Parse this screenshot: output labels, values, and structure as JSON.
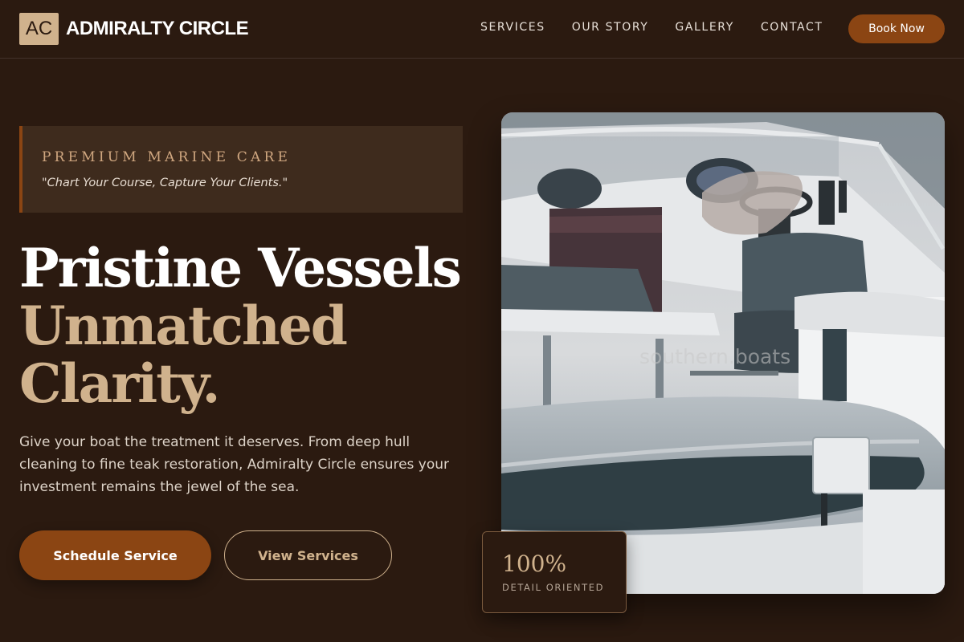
{
  "brand": {
    "mark": "AC",
    "name": "ADMIRALTY CIRCLE"
  },
  "nav": {
    "items": [
      {
        "label": "SERVICES"
      },
      {
        "label": "OUR STORY"
      },
      {
        "label": "GALLERY"
      },
      {
        "label": "CONTACT"
      }
    ],
    "cta_label": "Book Now"
  },
  "tagline": {
    "kicker": "PREMIUM MARINE CARE",
    "quote": "\"Chart Your Course, Capture Your Clients.\""
  },
  "hero": {
    "headline_line1": "Pristine Vessels",
    "headline_line2": "Unmatched",
    "headline_line3": "Clarity.",
    "lede": "Give your boat the treatment it deserves. From deep hull cleaning to fine teak restoration, Admiralty Circle ensures your investment remains the jewel of the sea.",
    "primary_cta": "Schedule Service",
    "secondary_cta": "View Services"
  },
  "image": {
    "watermark": "southern.boats"
  },
  "stat": {
    "value": "100%",
    "label": "DETAIL ORIENTED"
  },
  "colors": {
    "background": "#2b1a10",
    "accent": "#8b4513",
    "gold": "#d0b28d",
    "panel": "#3e2b1d"
  }
}
